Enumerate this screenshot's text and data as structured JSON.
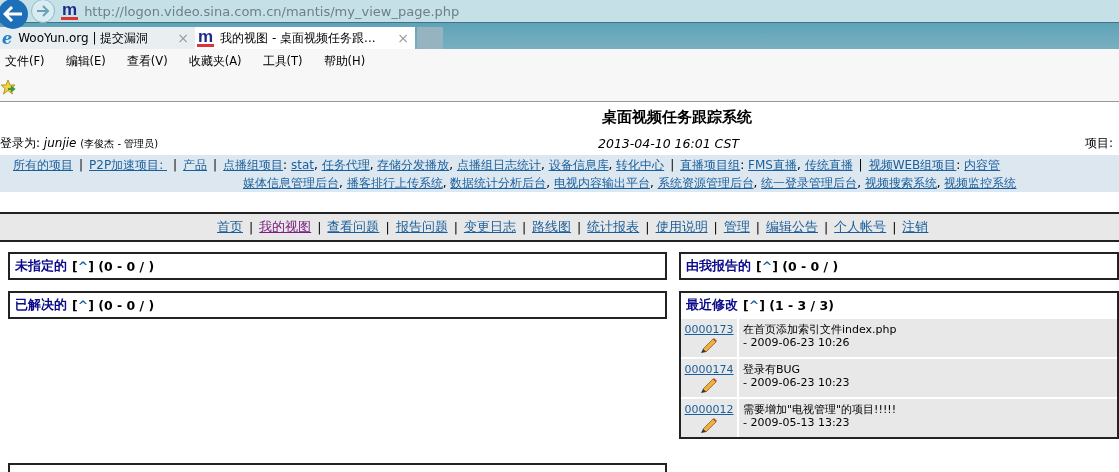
{
  "browser": {
    "url": "http://logon.video.sina.com.cn/mantis/my_view_page.php",
    "site_logo": "m",
    "tabs": [
      {
        "title": "WooYun.org | 提交漏洞",
        "icon": "e",
        "close": "×",
        "selected": false
      },
      {
        "title": "我的视图 - 桌面视频任务跟...",
        "icon": "m",
        "close": "×",
        "selected": true
      }
    ],
    "menu": [
      "文件(F)",
      "编辑(E)",
      "查看(V)",
      "收藏夹(A)",
      "工具(T)",
      "帮助(H)"
    ]
  },
  "page": {
    "title": "桌面视频任务跟踪系统",
    "login_label": "登录为:",
    "user": "junjie",
    "user_detail": "(李俊杰 - 管理员)",
    "datetime": "2013-04-10 16:01 CST",
    "project_label": "项目:",
    "project_lines": [
      [
        {
          "text": "所有的项目",
          "kind": "link"
        },
        {
          "text": "|",
          "kind": "sep"
        },
        {
          "text": "P2P加速项目: ",
          "kind": "link"
        },
        {
          "text": "|",
          "kind": "sep"
        },
        {
          "text": "产品",
          "kind": "link"
        },
        {
          "text": "|",
          "kind": "sep"
        },
        {
          "text": "点播组项目",
          "kind": "link"
        },
        {
          "text": ": ",
          "kind": "plain"
        },
        {
          "text": "stat",
          "kind": "link"
        },
        {
          "text": ", ",
          "kind": "plain"
        },
        {
          "text": "任务代理",
          "kind": "link"
        },
        {
          "text": ", ",
          "kind": "plain"
        },
        {
          "text": "存储分发播放",
          "kind": "link"
        },
        {
          "text": ", ",
          "kind": "plain"
        },
        {
          "text": "点播组日志统计",
          "kind": "link"
        },
        {
          "text": ", ",
          "kind": "plain"
        },
        {
          "text": "设备信息库",
          "kind": "link"
        },
        {
          "text": ", ",
          "kind": "plain"
        },
        {
          "text": "转化中心",
          "kind": "link"
        },
        {
          "text": "|",
          "kind": "sep"
        },
        {
          "text": "直播项目组",
          "kind": "link"
        },
        {
          "text": ": ",
          "kind": "plain"
        },
        {
          "text": "FMS直播",
          "kind": "link"
        },
        {
          "text": ", ",
          "kind": "plain"
        },
        {
          "text": "传统直播",
          "kind": "link"
        },
        {
          "text": "|",
          "kind": "sep"
        },
        {
          "text": "视频WEB组项目",
          "kind": "link"
        },
        {
          "text": ": ",
          "kind": "plain"
        },
        {
          "text": "内容管",
          "kind": "link"
        }
      ],
      [
        {
          "text": "媒体信息管理后台",
          "kind": "link"
        },
        {
          "text": ", ",
          "kind": "plain"
        },
        {
          "text": "播客排行上传系统",
          "kind": "link"
        },
        {
          "text": ", ",
          "kind": "plain"
        },
        {
          "text": "数据统计分析后台",
          "kind": "link"
        },
        {
          "text": ", ",
          "kind": "plain"
        },
        {
          "text": "电视内容输出平台",
          "kind": "link"
        },
        {
          "text": ", ",
          "kind": "plain"
        },
        {
          "text": "系统资源管理后台",
          "kind": "link"
        },
        {
          "text": ", ",
          "kind": "plain"
        },
        {
          "text": "统一登录管理后台",
          "kind": "link"
        },
        {
          "text": ", ",
          "kind": "plain"
        },
        {
          "text": "视频搜索系统",
          "kind": "link"
        },
        {
          "text": ", ",
          "kind": "plain"
        },
        {
          "text": "视频监控系统",
          "kind": "link"
        }
      ]
    ],
    "nav": [
      {
        "text": "首页",
        "kind": "link",
        "selected": false
      },
      {
        "text": "|",
        "kind": "sep"
      },
      {
        "text": "我的视图",
        "kind": "link",
        "selected": true
      },
      {
        "text": "|",
        "kind": "sep"
      },
      {
        "text": "查看问题",
        "kind": "link",
        "selected": false
      },
      {
        "text": "|",
        "kind": "sep"
      },
      {
        "text": "报告问题",
        "kind": "link",
        "selected": false
      },
      {
        "text": "|",
        "kind": "sep"
      },
      {
        "text": "变更日志",
        "kind": "link",
        "selected": false
      },
      {
        "text": "|",
        "kind": "sep"
      },
      {
        "text": "路线图",
        "kind": "link",
        "selected": false
      },
      {
        "text": "|",
        "kind": "sep"
      },
      {
        "text": "统计报表",
        "kind": "link",
        "selected": false
      },
      {
        "text": "|",
        "kind": "sep"
      },
      {
        "text": "使用说明",
        "kind": "link",
        "selected": false
      },
      {
        "text": "|",
        "kind": "sep"
      },
      {
        "text": "管理",
        "kind": "link",
        "selected": false
      },
      {
        "text": "|",
        "kind": "sep"
      },
      {
        "text": "编辑公告",
        "kind": "link",
        "selected": false
      },
      {
        "text": "|",
        "kind": "sep"
      },
      {
        "text": "个人帐号",
        "kind": "link",
        "selected": false
      },
      {
        "text": "|",
        "kind": "sep"
      },
      {
        "text": "注销",
        "kind": "link",
        "selected": false
      }
    ],
    "left_boxes": [
      {
        "title": "未指定的",
        "open": "[",
        "link": "^",
        "rest": "] (0 - 0 / )"
      },
      {
        "title": "已解决的",
        "open": "[",
        "link": "^",
        "rest": "] (0 - 0 / )"
      }
    ],
    "right_boxes": [
      {
        "title": "由我报告的",
        "open": "[",
        "link": "^",
        "rest": "] (0 - 0 / )"
      },
      {
        "title": "最近修改",
        "open": "[",
        "link": "^",
        "rest": "] (1 - 3 / 3)",
        "rows": [
          {
            "id": "0000173",
            "summary": "在首页添加索引文件index.php",
            "date": "- 2009-06-23 10:26"
          },
          {
            "id": "0000174",
            "summary": "登录有BUG",
            "date": "- 2009-06-23 10:23"
          },
          {
            "id": "0000012",
            "summary": "需要增加\"电视管理\"的项目!!!!!",
            "date": "- 2009-05-13 13:23"
          }
        ]
      }
    ]
  }
}
